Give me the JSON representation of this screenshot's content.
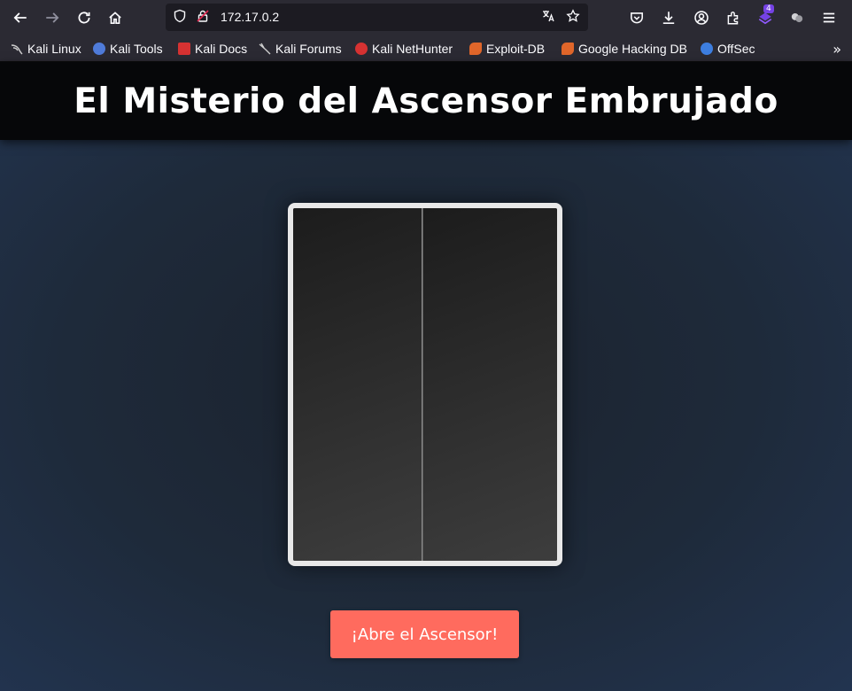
{
  "browser": {
    "url": "172.17.0.2",
    "extension_badge": "4",
    "bookmarks": [
      {
        "label": "Kali Linux",
        "icon": "kali-dragon-icon",
        "color": "#cccccc"
      },
      {
        "label": "Kali Tools",
        "icon": "kali-tools-icon",
        "color": "#4f7bd9"
      },
      {
        "label": "Kali Docs",
        "icon": "kali-docs-icon",
        "color": "#d63232"
      },
      {
        "label": "Kali Forums",
        "icon": "kali-forums-icon",
        "color": "#cccccc"
      },
      {
        "label": "Kali NetHunter",
        "icon": "nethunter-icon",
        "color": "#d63232"
      },
      {
        "label": "Exploit-DB",
        "icon": "exploit-db-icon",
        "color": "#e0662a"
      },
      {
        "label": "Google Hacking DB",
        "icon": "ghdb-icon",
        "color": "#e0662a"
      },
      {
        "label": "OffSec",
        "icon": "offsec-icon",
        "color": "#3d7ee0"
      }
    ]
  },
  "page": {
    "title": "El Misterio del Ascensor Embrujado",
    "button_label": "¡Abre el Ascensor!",
    "button_color": "#ff6b5e"
  }
}
